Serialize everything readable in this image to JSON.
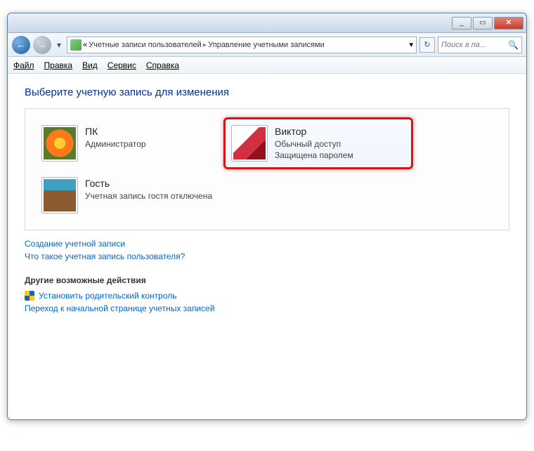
{
  "titlebar": {
    "min": "_",
    "max": "▭",
    "close": "✕"
  },
  "nav": {
    "back": "←",
    "fwd": "→",
    "chev": "▾",
    "crumb_prefix": "«",
    "crumb1": "Учетные записи пользователей",
    "crumb2": "Управление учетными записями",
    "dropdown": "▾",
    "refresh": "↻",
    "search_placeholder": "Поиск в па...",
    "search_icon": "🔍"
  },
  "menu": {
    "file": "Файл",
    "edit": "Правка",
    "view": "Вид",
    "tools": "Сервис",
    "help": "Справка"
  },
  "heading": "Выберите учетную запись для изменения",
  "accounts": [
    {
      "name": "ПК",
      "line1": "Администратор",
      "line2": ""
    },
    {
      "name": "Виктор",
      "line1": "Обычный доступ",
      "line2": "Защищена паролем"
    },
    {
      "name": "Гость",
      "line1": "Учетная запись гостя отключена",
      "line2": ""
    }
  ],
  "links": {
    "create": "Создание учетной записи",
    "what": "Что такое учетная запись пользователя?"
  },
  "other_section": "Другие возможные действия",
  "other_links": {
    "parental": "Установить родительский контроль",
    "home": "Переход к начальной странице учетных записей"
  }
}
